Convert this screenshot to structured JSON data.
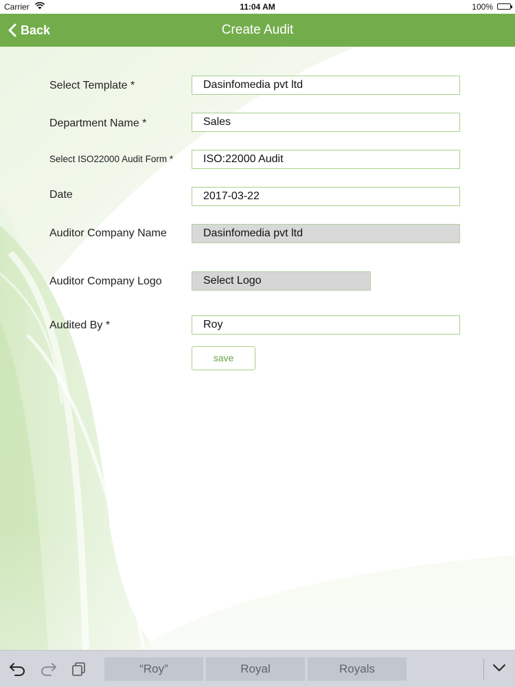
{
  "status_bar": {
    "carrier": "Carrier",
    "time": "11:04 AM",
    "battery": "100%",
    "battery_level": 1.0
  },
  "nav": {
    "back_label": "Back",
    "title": "Create Audit"
  },
  "form": {
    "template": {
      "label": "Select Template *",
      "value": "Dasinfomedia pvt ltd"
    },
    "department": {
      "label": "Department Name *",
      "value": "Sales"
    },
    "audit_form": {
      "label": "Select ISO22000 Audit Form *",
      "value": "ISO:22000 Audit"
    },
    "date": {
      "label": "Date",
      "value": "2017-03-22"
    },
    "company_name": {
      "label": "Auditor Company Name",
      "value": "Dasinfomedia pvt ltd"
    },
    "company_logo": {
      "label": "Auditor Company Logo",
      "button_label": "Select Logo"
    },
    "audited_by": {
      "label": "Audited By *",
      "value": "Roy"
    },
    "save_label": "save"
  },
  "keyboard": {
    "suggestions": [
      "“Roy”",
      "Royal",
      "Royals"
    ],
    "icons": [
      "undo-icon",
      "redo-icon",
      "paste-icon",
      "dismiss-keyboard-icon"
    ]
  },
  "colors": {
    "nav_green": "#73ad4b",
    "field_border": "#a8d08a",
    "save_text": "#6aa34a",
    "readonly_bg": "#d8d8d8",
    "keyboard_bg": "#d2d5db"
  }
}
